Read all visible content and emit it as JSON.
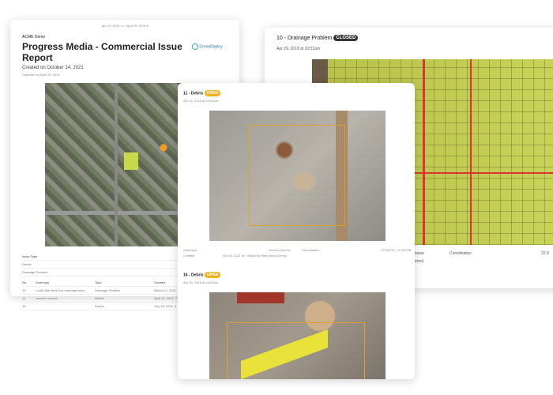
{
  "left": {
    "date_from": "Apr 29, 2019",
    "date_to": "April 29, 2019",
    "org": "ACME Demo",
    "title": "Progress Media - Commercial Issue Report",
    "created": "Created on October 14, 2021",
    "captured": "Captured on April 29, 2019",
    "logo": "DroneDeploy",
    "issue_type_label": "Issue Type",
    "issue_types": [
      "Debris",
      "Drainage Problem"
    ],
    "table": {
      "headers": [
        "No.",
        "Summary",
        "Type",
        "Created"
      ],
      "rows": [
        [
          "10",
          "Looks like there is a drainage issue",
          "Drainage Problem",
          "March 22, 2021, 8"
        ],
        [
          "11",
          "need to remove",
          "Debris",
          "April 20, 2021, 7"
        ],
        [
          "16",
          "",
          "Debris",
          "July 28, 2021, 4"
        ]
      ]
    }
  },
  "right": {
    "title": "10 - Drainage Problem",
    "status": "CLOSED",
    "date": "Apr 29, 2019 at 10:51am",
    "issue_frag": "Issue",
    "coords_label": "Coordinates:",
    "coords_frag": "22.9",
    "demo_frag": "emo)"
  },
  "front": {
    "issue1": {
      "title": "11 - Debris",
      "status": "OPEN",
      "date": "Apr 29, 2019 at 10:51am",
      "summary_label": "Summary",
      "summary": "need to remove",
      "coords_label": "Coordinates:",
      "coords": "22.95743, -97.00768",
      "created_label": "Created",
      "created": "Apr 20, 2021 at 7:35am by Mike Winn (Demo)"
    },
    "issue2": {
      "title": "16 - Debris",
      "status": "OPEN",
      "date": "Apr 29, 2019 at 10:51am"
    }
  },
  "colors": {
    "open": "#f2b322",
    "closed": "#333333",
    "annotation": "#e0a030"
  }
}
